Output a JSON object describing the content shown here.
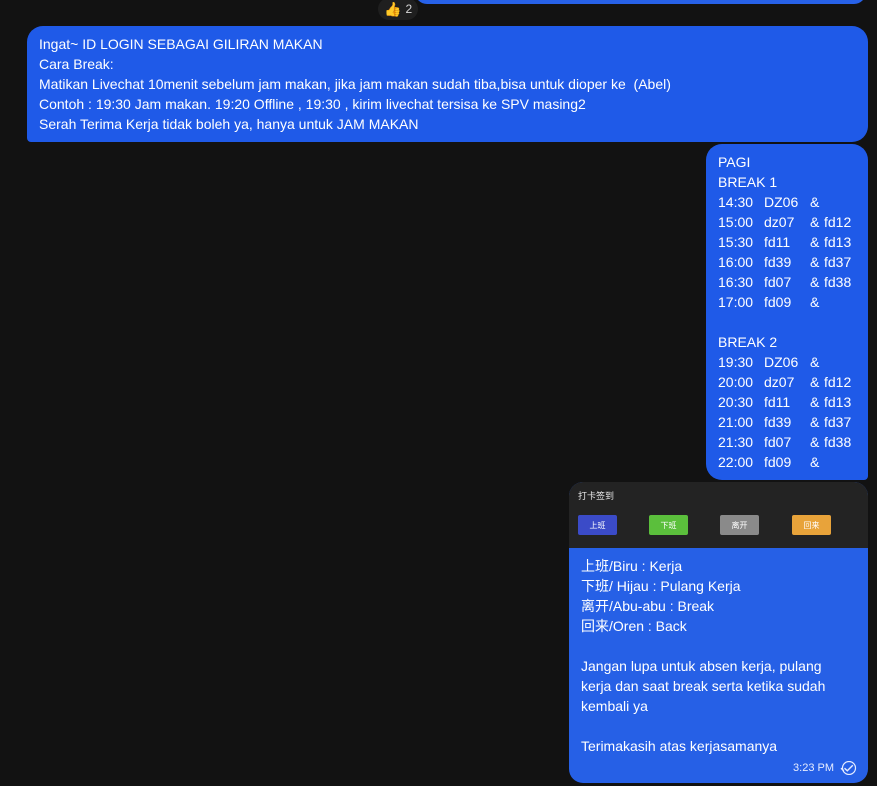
{
  "reaction": {
    "emoji": "👍",
    "count": "2"
  },
  "rules_message": {
    "lines": [
      "Ingat~ ID LOGIN SEBAGAI GILIRAN MAKAN",
      "Cara Break:",
      "Matikan Livechat 10menit sebelum jam makan, jika jam makan sudah tiba,bisa untuk dioper ke  (Abel)",
      "Contoh : 19:30 Jam makan. 19:20 Offline , 19:30 , kirim livechat tersisa ke SPV masing2",
      "Serah Terima Kerja tidak boleh ya, hanya untuk JAM MAKAN"
    ]
  },
  "schedule_message": {
    "title": "PAGI",
    "break1_label": "BREAK 1",
    "break1": [
      {
        "time": "14:30",
        "a": "DZ06",
        "amp": "&",
        "b": ""
      },
      {
        "time": "15:00",
        "a": "dz07",
        "amp": "&",
        "b": "fd12"
      },
      {
        "time": "15:30",
        "a": "fd11",
        "amp": "&",
        "b": "fd13"
      },
      {
        "time": "16:00",
        "a": "fd39",
        "amp": "&",
        "b": "fd37"
      },
      {
        "time": "16:30",
        "a": "fd07",
        "amp": "&",
        "b": "fd38"
      },
      {
        "time": "17:00",
        "a": "fd09",
        "amp": "&",
        "b": ""
      }
    ],
    "break2_label": "BREAK 2",
    "break2": [
      {
        "time": "19:30",
        "a": "DZ06",
        "amp": "&",
        "b": ""
      },
      {
        "time": "20:00",
        "a": "dz07",
        "amp": "&",
        "b": "fd12"
      },
      {
        "time": "20:30",
        "a": "fd11",
        "amp": "&",
        "b": "fd13"
      },
      {
        "time": "21:00",
        "a": "fd39",
        "amp": "&",
        "b": "fd37"
      },
      {
        "time": "21:30",
        "a": "fd07",
        "amp": "&",
        "b": "fd38"
      },
      {
        "time": "22:00",
        "a": "fd09",
        "amp": "&",
        "b": ""
      }
    ]
  },
  "attendance_card": {
    "title": "打卡签到",
    "buttons": [
      {
        "label": "上班",
        "color": "#3b4bc8"
      },
      {
        "label": "下班",
        "color": "#5bbf3c"
      },
      {
        "label": "离开",
        "color": "#8a8a8a"
      },
      {
        "label": "回来",
        "color": "#e8a33a"
      }
    ],
    "legend": [
      "上班/Biru : Kerja",
      "下班/ Hijau : Pulang Kerja",
      "离开/Abu-abu : Break",
      "回来/Oren : Back"
    ],
    "reminder_lines": [
      "Jangan lupa untuk absen kerja, pulang",
      "kerja dan saat break serta ketika sudah",
      "kembali ya"
    ],
    "thanks": "Terimakasih atas kerjasamanya",
    "time": "3:23 PM",
    "status_icon": "double-check-icon"
  }
}
